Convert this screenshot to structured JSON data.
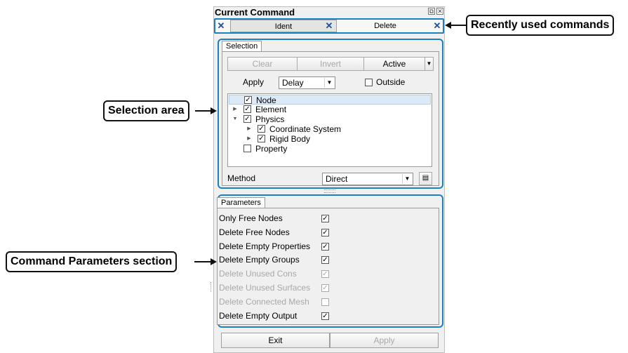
{
  "panel": {
    "title": "Current Command",
    "float_icon": "⧉",
    "close_icon": "✕"
  },
  "recent_tabs": {
    "items": [
      {
        "label": "Ident"
      },
      {
        "label": "Delete"
      }
    ],
    "close_glyph": "✕"
  },
  "selection": {
    "tab_label": "Selection",
    "clear_label": "Clear",
    "invert_label": "Invert",
    "active_label": "Active",
    "apply_label": "Apply",
    "apply_value": "Delay",
    "outside_label": "Outside",
    "outside_checked": false,
    "tree": [
      {
        "label": "Node",
        "checked": true
      },
      {
        "label": "Element",
        "checked": true
      },
      {
        "label": "Physics",
        "checked": true
      },
      {
        "label": "Coordinate System",
        "checked": true
      },
      {
        "label": "Rigid Body",
        "checked": true
      },
      {
        "label": "Property",
        "checked": false
      }
    ],
    "method_label": "Method",
    "method_value": "Direct"
  },
  "parameters": {
    "tab_label": "Parameters",
    "items": [
      {
        "label": "Only Free Nodes",
        "checked": true,
        "enabled": true
      },
      {
        "label": "Delete Free Nodes",
        "checked": true,
        "enabled": true
      },
      {
        "label": "Delete Empty Properties",
        "checked": true,
        "enabled": true
      },
      {
        "label": "Delete Empty Groups",
        "checked": true,
        "enabled": true
      },
      {
        "label": "Delete Unused Cons",
        "checked": true,
        "enabled": false
      },
      {
        "label": "Delete Unused Surfaces",
        "checked": true,
        "enabled": false
      },
      {
        "label": "Delete Connected Mesh",
        "checked": false,
        "enabled": false
      },
      {
        "label": "Delete Empty Output",
        "checked": true,
        "enabled": true
      }
    ]
  },
  "footer": {
    "exit_label": "Exit",
    "apply_label": "Apply"
  },
  "callouts": {
    "recent": "Recently used commands",
    "selection": "Selection area",
    "parameters": "Command Parameters section"
  },
  "colors": {
    "highlight": "#1b7fc0",
    "close_x": "#1d4f9e"
  }
}
